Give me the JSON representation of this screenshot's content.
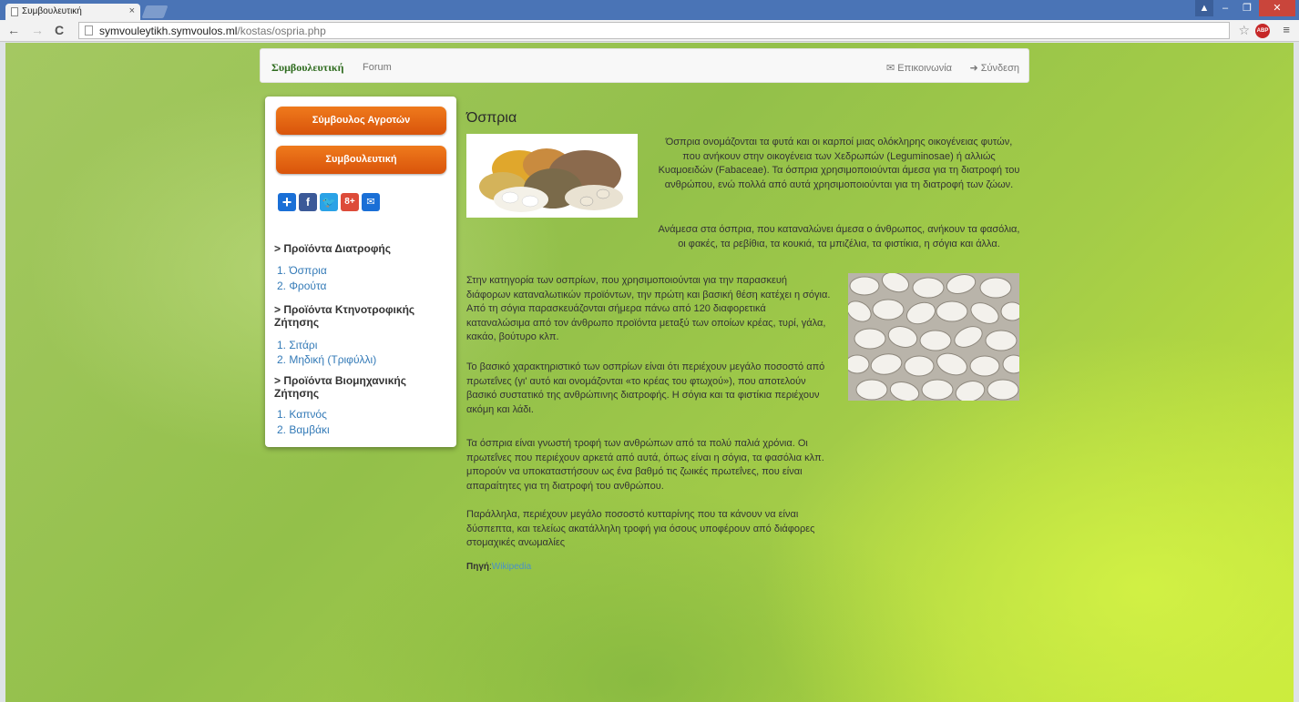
{
  "browser": {
    "tab_title": "Συμβουλευτική",
    "url_host": "symvouleytikh.symvoulos.ml",
    "url_path": "/kostas/ospria.php"
  },
  "navbar": {
    "brand": "Συμβουλευτική",
    "forum": "Forum",
    "contact": "✉ Επικοινωνία",
    "login": "➜ Σύνδεση"
  },
  "sidebar": {
    "button_1": "Σύμβουλος Αγροτών",
    "button_2": "Συμβουλευτική",
    "sections": [
      {
        "title": "> Προϊόντα Διατροφής",
        "items": [
          "1. Όσπρια",
          "2. Φρούτα"
        ]
      },
      {
        "title": "> Προϊόντα Κτηνοτροφικής Ζήτησης",
        "items": [
          "1. Σιτάρι",
          "2. Μηδική (Τριφύλλι)"
        ]
      },
      {
        "title": "> Προϊόντα Βιομηχανικής Ζήτησης",
        "items": [
          "1. Καπνός",
          "2. Βαμβάκι"
        ]
      }
    ]
  },
  "main": {
    "title": "Όσπρια",
    "paragraphs": [
      "Όσπρια ονομάζονται τα φυτά και οι καρποί μιας ολόκληρης οικογένειας φυτών, που ανήκουν στην οικογένεια των Χεδρωπών (Leguminosae) ή αλλιώς Κυαμοειδών (Fabaceae). Τα όσπρια χρησιμοποιούνται άμεσα για τη διατροφή του ανθρώπου, ενώ πολλά από αυτά χρησιμοποιούνται για τη διατροφή των ζώων.",
      "Ανάμεσα στα όσπρια, που καταναλώνει άμεσα ο άνθρωπος, ανήκουν τα φασόλια, οι φακές, τα ρεβίθια, τα κουκιά, τα μπιζέλια, τα φιστίκια, η σόγια και άλλα.",
      "Στην κατηγορία των οσπρίων, που χρησιμοποιούνται για την παρασκευή διάφορων καταναλωτικών προϊόντων, την πρώτη και βασική θέση κατέχει η σόγια. Από τη σόγια παρασκευάζονται σήμερα πάνω από 120 διαφορετικά καταναλώσιμα από τον άνθρωπο προϊόντα μεταξύ των οποίων κρέας, τυρί, γάλα, κακάο, βούτυρο κλπ.",
      "Το βασικό χαρακτηριστικό των οσπρίων είναι ότι περιέχουν μεγάλο ποσοστό από πρωτεΐνες (γι' αυτό και ονομάζονται «το κρέας του φτωχού»), που αποτελούν βασικό συστατικό της ανθρώπινης διατροφής. Η σόγια και τα φιστίκια περιέχουν ακόμη και λάδι.",
      "Τα όσπρια είναι γνωστή τροφή των ανθρώπων από τα πολύ παλιά χρόνια. Οι πρωτεΐνες που περιέχουν αρκετά από αυτά, όπως είναι η σόγια, τα φασόλια κλπ. μπορούν να υποκαταστήσουν ως ένα βαθμό τις ζωικές πρωτεΐνες, που είναι απαραίτητες για τη διατροφή του ανθρώπου.",
      "Παράλληλα, περιέχουν μεγάλο ποσοστό κυτταρίνης που τα κάνουν να είναι δύσπεπτα, και τελείως ακατάλληλη τροφή για όσους υποφέρουν από διάφορες στομαχικές ανωμαλίες"
    ],
    "source_label": "Πηγή",
    "source_link": "Wikipedia"
  }
}
